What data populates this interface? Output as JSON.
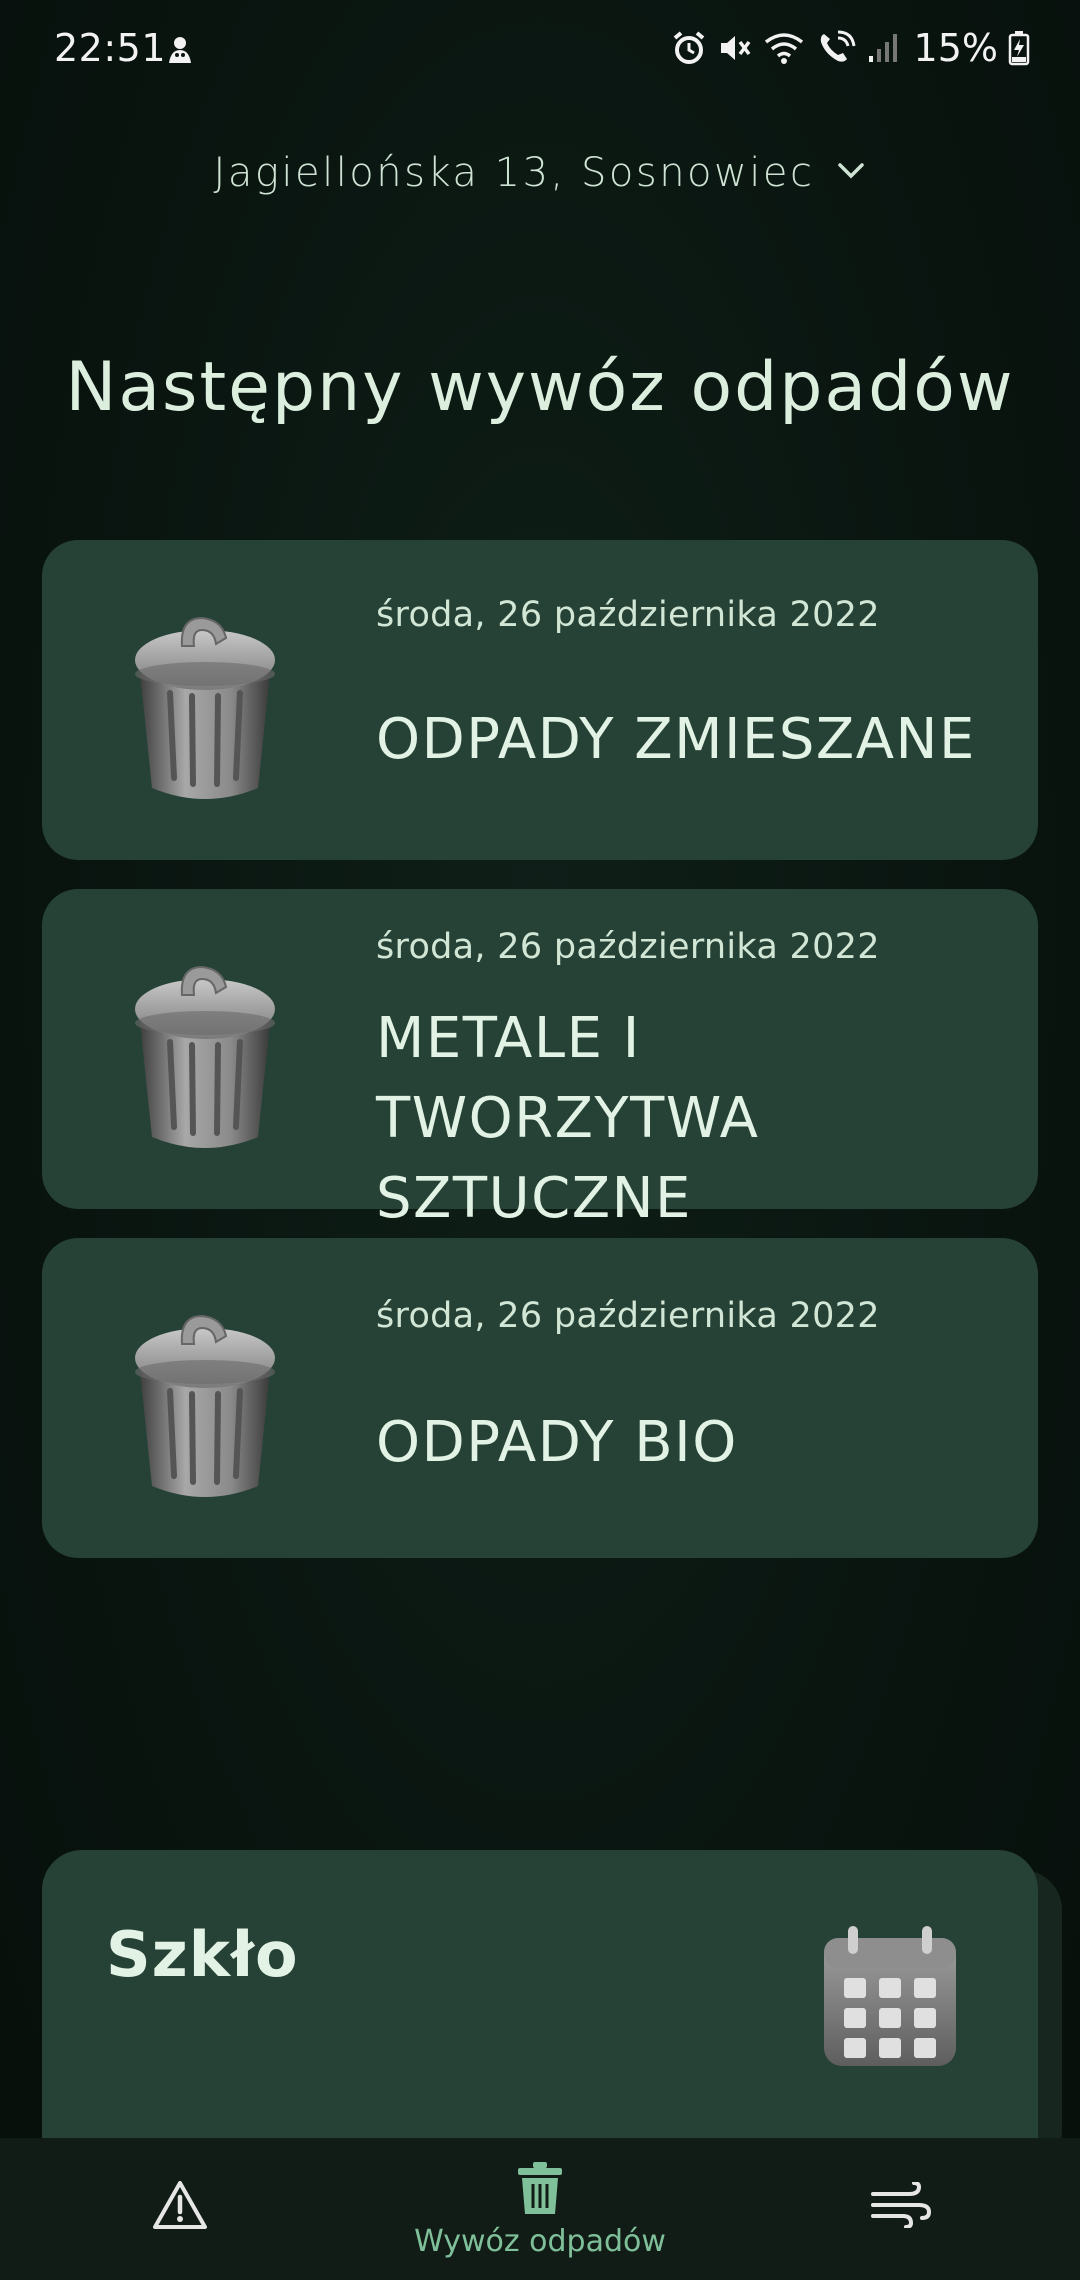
{
  "status_bar": {
    "time": "22:51",
    "battery": "15%",
    "icons": [
      "notification-icon",
      "alarm-icon",
      "mute-icon",
      "wifi-icon",
      "wifi-call-icon",
      "signal-icon",
      "battery-charging-icon"
    ]
  },
  "location": {
    "address": "Jagiellońska 13, Sosnowiec",
    "icon": "chevron-down-icon"
  },
  "page_title": "Następny wywóz odpadów",
  "collections": [
    {
      "date": "środa, 26 października 2022",
      "type": "ODPADY ZMIESZANE",
      "icon": "trash-can-icon"
    },
    {
      "date": "środa, 26 października 2022",
      "type": "METALE I TWORZYTWA SZTUCZNE",
      "icon": "trash-can-icon"
    },
    {
      "date": "środa, 26 października 2022",
      "type": "ODPADY BIO",
      "icon": "trash-can-icon"
    }
  ],
  "calendar_card": {
    "title": "Szkło",
    "icon": "calendar-icon"
  },
  "bottom_nav": {
    "items": [
      {
        "label": "",
        "icon": "warning-icon",
        "active": false
      },
      {
        "label": "Wywóz odpadów",
        "icon": "trash-icon",
        "active": true
      },
      {
        "label": "",
        "icon": "wind-icon",
        "active": false
      }
    ]
  },
  "colors": {
    "background": "#0a1510",
    "card": "#264236",
    "text": "#dcefdf",
    "accent": "#7fc09a"
  }
}
